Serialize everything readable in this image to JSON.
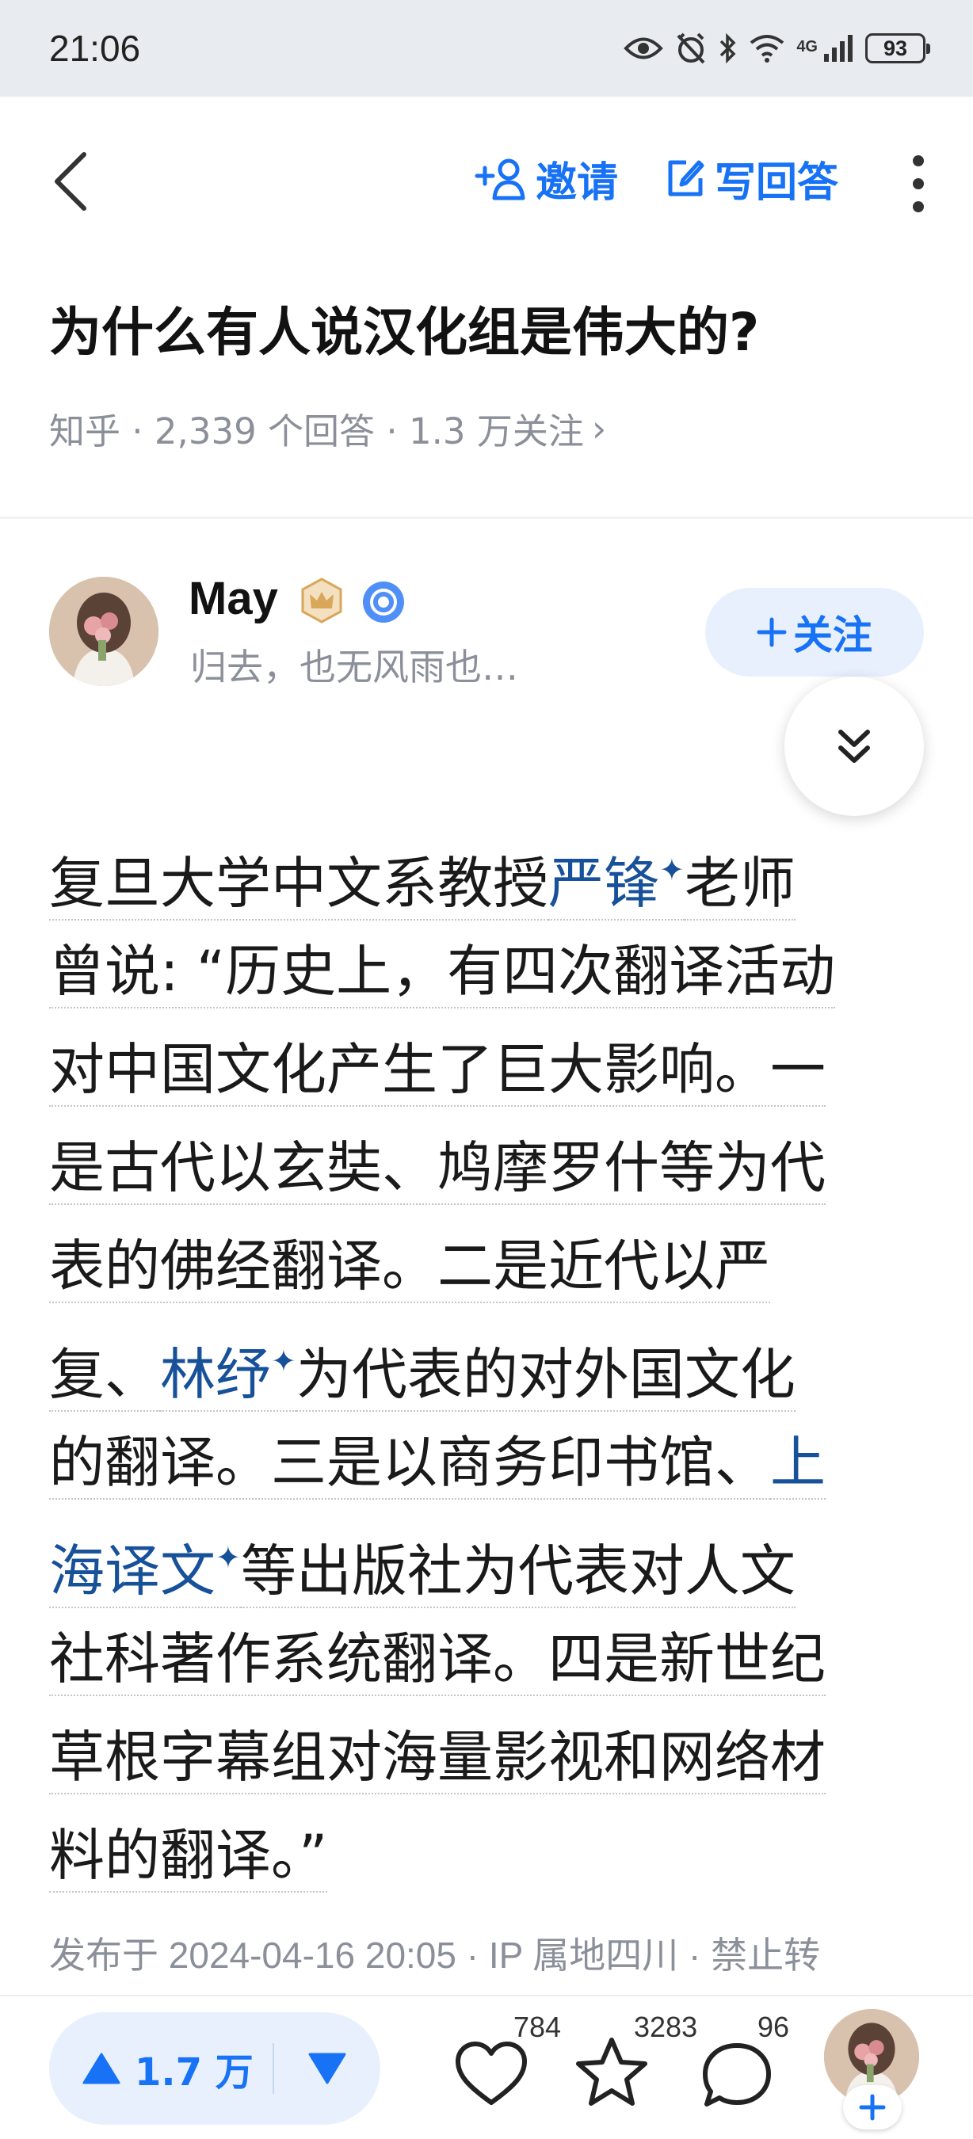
{
  "status_bar": {
    "time": "21:06",
    "network": "4G",
    "battery": "93"
  },
  "nav": {
    "invite_label": "邀请",
    "write_answer_label": "写回答"
  },
  "question": {
    "title": "为什么有人说汉化组是伟大的?",
    "meta": "知乎 · 2,339 个回答 · 1.3 万关注",
    "meta_arrow": "›"
  },
  "author": {
    "name": "May",
    "bio": "归去，也无风雨也…",
    "follow_label": "关注"
  },
  "answer": {
    "lines": [
      [
        "复旦大学中文系教授",
        "严锋",
        "老师"
      ],
      [
        "曾说: “历史上，有四次翻译活动"
      ],
      [
        "对中国文化产生了巨大影响。一"
      ],
      [
        "是古代以玄奘、鸠摩罗什等为代"
      ],
      [
        "表的佛经翻译。二是近代以严"
      ],
      [
        "复、",
        "林纾",
        "为代表的对外国文化"
      ],
      [
        "的翻译。三是以商务印书馆、",
        "上"
      ],
      [
        "海译文",
        "等出版社为代表对人文"
      ],
      [
        "社科著作系统翻译。四是新世纪"
      ],
      [
        "草根字幕组对海量影视和网络材"
      ],
      [
        "料的翻译。”"
      ]
    ],
    "link_mark": "✦",
    "publish_info": "发布于 2024-04-16 20:05 · IP 属地四川 · 禁止转"
  },
  "bottom_bar": {
    "upvote_count": "1.7 万",
    "like_count": "784",
    "collect_count": "3283",
    "comment_count": "96"
  },
  "colors": {
    "accent": "#1772f6",
    "link": "#175199",
    "muted": "#8a8f99",
    "pill_bg": "#e8f0fd"
  }
}
